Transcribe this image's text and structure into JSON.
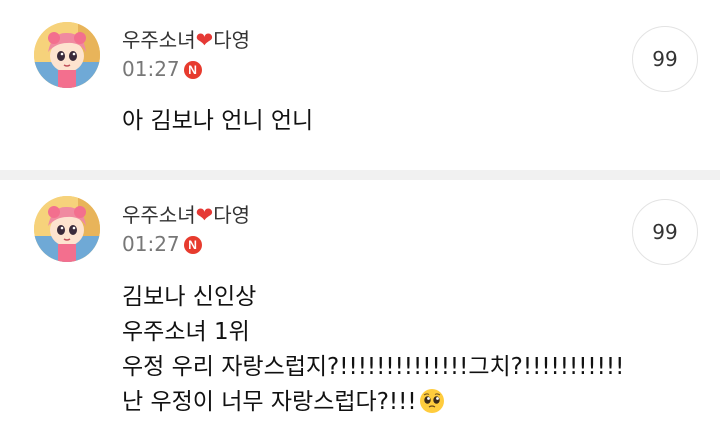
{
  "posts": [
    {
      "author_prefix": "우주소녀",
      "author_heart": "❤",
      "author_suffix": "다영",
      "time": "01:27",
      "badge": "N",
      "counter": "99",
      "lines": [
        "아 김보나 언니 언니"
      ]
    },
    {
      "author_prefix": "우주소녀",
      "author_heart": "❤",
      "author_suffix": "다영",
      "time": "01:27",
      "badge": "N",
      "counter": "99",
      "lines": [
        "김보나 신인상",
        "우주소녀 1위",
        "우정 우리 자랑스럽지?!!!!!!!!!!!!!!그치?!!!!!!!!!!!",
        "난 우정이 너무 자랑스럽다?!!!"
      ],
      "trailing_emoji": "pleading-face-icon"
    }
  ],
  "colors": {
    "badge": "#e73b2e",
    "heart": "#e53935",
    "divider": "#f1f1f1"
  }
}
